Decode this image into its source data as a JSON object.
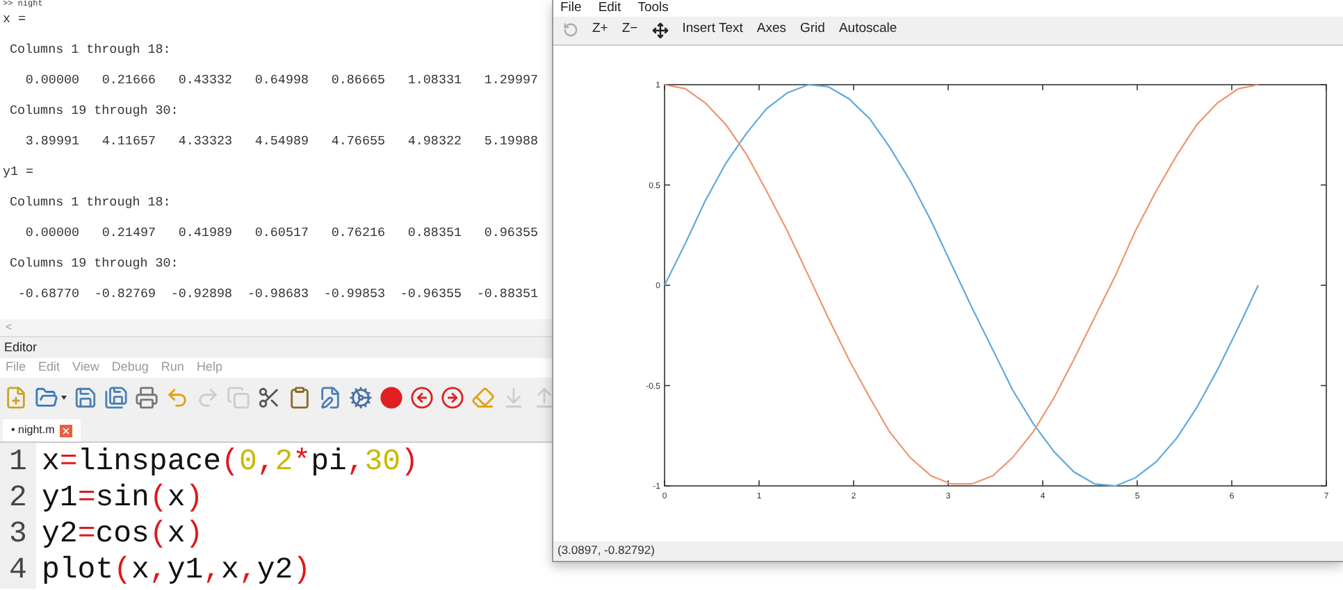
{
  "console": {
    "prompt": ">> night",
    "blocks": [
      {
        "kind": "var",
        "text": "x ="
      },
      {
        "kind": "heading",
        "text": "Columns 1 through 18:"
      },
      {
        "kind": "values",
        "values": [
          "0.00000",
          "0.21666",
          "0.43332",
          "0.64998",
          "0.86665",
          "1.08331",
          "1.29997"
        ]
      },
      {
        "kind": "heading",
        "text": "Columns 19 through 30:"
      },
      {
        "kind": "values",
        "values": [
          "3.89991",
          "4.11657",
          "4.33323",
          "4.54989",
          "4.76655",
          "4.98322",
          "5.19988"
        ]
      },
      {
        "kind": "var",
        "text": "y1 ="
      },
      {
        "kind": "heading",
        "text": "Columns 1 through 18:"
      },
      {
        "kind": "values",
        "values": [
          "0.00000",
          "0.21497",
          "0.41989",
          "0.60517",
          "0.76216",
          "0.88351",
          "0.96355"
        ]
      },
      {
        "kind": "heading",
        "text": "Columns 19 through 30:"
      },
      {
        "kind": "values",
        "values": [
          "-0.68770",
          "-0.82769",
          "-0.92898",
          "-0.98683",
          "-0.99853",
          "-0.96355",
          "-0.88351"
        ]
      }
    ],
    "scroll_arrow": "<"
  },
  "editor": {
    "title": "Editor",
    "menu": [
      "File",
      "Edit",
      "View",
      "Debug",
      "Run",
      "Help"
    ],
    "toolbar": [
      {
        "kind": "new",
        "disabled": false
      },
      {
        "kind": "open",
        "disabled": false
      },
      {
        "kind": "save",
        "disabled": false
      },
      {
        "kind": "saveas",
        "disabled": false
      },
      {
        "kind": "print",
        "disabled": false
      },
      {
        "kind": "undo",
        "disabled": false
      },
      {
        "kind": "redo",
        "disabled": true
      },
      {
        "kind": "copy",
        "disabled": true
      },
      {
        "kind": "cut",
        "disabled": false
      },
      {
        "kind": "paste",
        "disabled": false
      },
      {
        "kind": "edit",
        "disabled": false
      },
      {
        "kind": "run",
        "disabled": false
      },
      {
        "kind": "breakpoint",
        "disabled": false
      },
      {
        "kind": "prevbreak",
        "disabled": false
      },
      {
        "kind": "nextbreak",
        "disabled": false
      },
      {
        "kind": "clearbreak",
        "disabled": false
      },
      {
        "kind": "stepin",
        "disabled": true
      },
      {
        "kind": "stepout",
        "disabled": true
      }
    ],
    "tabs": [
      {
        "label": "• night.m",
        "selected": true
      }
    ],
    "lines": [
      {
        "number": "1",
        "tokens": [
          {
            "kind": "plain",
            "text": "x"
          },
          {
            "kind": "op",
            "text": "="
          },
          {
            "kind": "plain",
            "text": "linspace"
          },
          {
            "kind": "op",
            "text": "("
          },
          {
            "kind": "num",
            "text": "0"
          },
          {
            "kind": "op",
            "text": ","
          },
          {
            "kind": "num",
            "text": "2"
          },
          {
            "kind": "op",
            "text": "*"
          },
          {
            "kind": "plain",
            "text": "pi"
          },
          {
            "kind": "op",
            "text": ","
          },
          {
            "kind": "num",
            "text": "30"
          },
          {
            "kind": "op",
            "text": ")"
          }
        ]
      },
      {
        "number": "2",
        "tokens": [
          {
            "kind": "plain",
            "text": "y1"
          },
          {
            "kind": "op",
            "text": "="
          },
          {
            "kind": "plain",
            "text": "sin"
          },
          {
            "kind": "op",
            "text": "("
          },
          {
            "kind": "plain",
            "text": "x"
          },
          {
            "kind": "op",
            "text": ")"
          }
        ]
      },
      {
        "number": "3",
        "tokens": [
          {
            "kind": "plain",
            "text": "y2"
          },
          {
            "kind": "op",
            "text": "="
          },
          {
            "kind": "plain",
            "text": "cos"
          },
          {
            "kind": "op",
            "text": "("
          },
          {
            "kind": "plain",
            "text": "x"
          },
          {
            "kind": "op",
            "text": ")"
          }
        ]
      },
      {
        "number": "4",
        "tokens": [
          {
            "kind": "plain",
            "text": "plot"
          },
          {
            "kind": "op",
            "text": "("
          },
          {
            "kind": "plain",
            "text": "x"
          },
          {
            "kind": "op",
            "text": ","
          },
          {
            "kind": "plain",
            "text": "y1"
          },
          {
            "kind": "op",
            "text": ","
          },
          {
            "kind": "plain",
            "text": "x"
          },
          {
            "kind": "op",
            "text": ","
          },
          {
            "kind": "plain",
            "text": "y2"
          },
          {
            "kind": "op",
            "text": ")"
          }
        ]
      }
    ]
  },
  "figure": {
    "menu": [
      "File",
      "Edit",
      "Tools"
    ],
    "toolbar": [
      {
        "kind": "rotate",
        "disabled": true
      },
      {
        "kind": "text",
        "label": "Z+",
        "disabled": false
      },
      {
        "kind": "text",
        "label": "Z−",
        "disabled": false
      },
      {
        "kind": "pan",
        "disabled": false
      },
      {
        "kind": "text",
        "label": "Insert Text",
        "disabled": false
      },
      {
        "kind": "text",
        "label": "Axes",
        "disabled": false
      },
      {
        "kind": "text",
        "label": "Grid",
        "disabled": false
      },
      {
        "kind": "text",
        "label": "Autoscale",
        "disabled": false
      }
    ],
    "chart_data": {
      "type": "line",
      "x": [
        0,
        0.22,
        0.43,
        0.65,
        0.87,
        1.08,
        1.3,
        1.52,
        1.73,
        1.95,
        2.17,
        2.38,
        2.6,
        2.82,
        3.03,
        3.25,
        3.47,
        3.68,
        3.9,
        4.12,
        4.33,
        4.55,
        4.77,
        4.98,
        5.2,
        5.42,
        5.63,
        5.85,
        6.07,
        6.28
      ],
      "series": [
        {
          "color": "#5fa9dc",
          "values": [
            0,
            0.21,
            0.42,
            0.61,
            0.76,
            0.88,
            0.96,
            1,
            0.99,
            0.93,
            0.83,
            0.69,
            0.52,
            0.32,
            0.11,
            -0.11,
            -0.32,
            -0.52,
            -0.69,
            -0.83,
            -0.93,
            -0.99,
            -1,
            -0.96,
            -0.88,
            -0.76,
            -0.61,
            -0.42,
            -0.21,
            0
          ]
        },
        {
          "color": "#ee9470",
          "values": [
            1,
            0.98,
            0.91,
            0.8,
            0.65,
            0.47,
            0.27,
            0.05,
            -0.16,
            -0.37,
            -0.56,
            -0.73,
            -0.86,
            -0.95,
            -0.99,
            -0.99,
            -0.95,
            -0.86,
            -0.73,
            -0.56,
            -0.37,
            -0.16,
            0.05,
            0.27,
            0.47,
            0.65,
            0.8,
            0.91,
            0.98,
            1
          ]
        }
      ],
      "xlim": [
        0,
        7
      ],
      "ylim": [
        -1,
        1
      ],
      "xticks": [
        0,
        1,
        2,
        3,
        4,
        5,
        6,
        7
      ],
      "yticks": [
        -1,
        -0.5,
        0,
        0.5,
        1
      ]
    },
    "status": "(3.0897, -0.82792)"
  }
}
